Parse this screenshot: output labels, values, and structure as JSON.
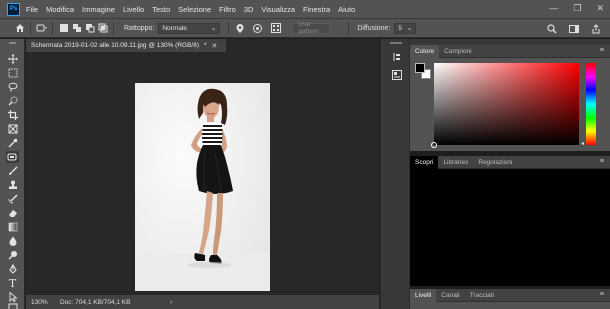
{
  "app": {
    "logo_text": "Ps",
    "menu": [
      "File",
      "Modifica",
      "Immagine",
      "Livello",
      "Testo",
      "Selezione",
      "Filtro",
      "3D",
      "Visualizza",
      "Finestra",
      "Aiuto"
    ],
    "window_controls": [
      "—",
      "❐",
      "✕"
    ]
  },
  "options_bar": {
    "rattoppo_label": "Rattoppo:",
    "rattoppo_value": "Normale",
    "use_pattern_label": "Usa pattern",
    "diffusione_label": "Diffusione:",
    "diffusione_value": "5"
  },
  "document": {
    "tab_title": "Schermata 2019-01-02 alle 10.09.11.jpg @ 130% (RGB/8)",
    "tab_modified": "*",
    "close_glyph": "✕",
    "zoom": "130%",
    "doc_info": "Doc: 704,1 KB/704,1 KB",
    "status_arrow": "›"
  },
  "panels": {
    "color_tabs": [
      "Colore",
      "Campioni"
    ],
    "adjust_tabs": [
      "Scopri",
      "Libraries",
      "Regolazioni"
    ],
    "layers_tabs": [
      "Livelli",
      "Canali",
      "Tracciati"
    ]
  },
  "colors": {
    "foreground": "#000000",
    "background": "#ffffff",
    "picker_hue": "#ff0000",
    "accent": "#31a8ff"
  },
  "icons": {
    "toolbar": [
      "move-icon",
      "marquee-icon",
      "lasso-icon",
      "quick-selection-icon",
      "crop-icon",
      "frame-icon",
      "eyedropper-icon",
      "patch-tool-icon",
      "brush-icon",
      "clone-stamp-icon",
      "history-brush-icon",
      "eraser-icon",
      "gradient-icon",
      "blur-icon",
      "dodge-icon",
      "pen-icon",
      "type-icon",
      "path-selection-icon",
      "rectangle-icon"
    ]
  }
}
